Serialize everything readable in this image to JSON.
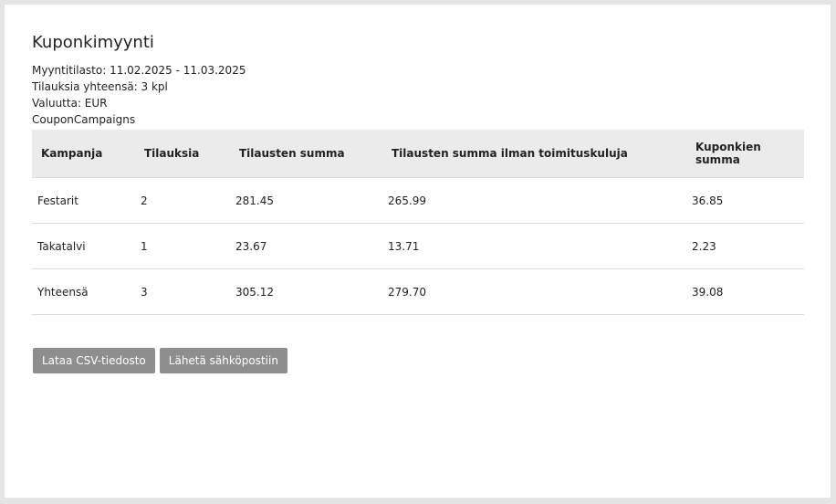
{
  "page": {
    "title": "Kuponkimyynti",
    "meta": [
      "Myyntitilasto: 11.02.2025 - 11.03.2025",
      "Tilauksia yhteensä: 3 kpl",
      "Valuutta: EUR",
      "CouponCampaigns"
    ]
  },
  "table": {
    "headers": [
      "Kampanja",
      "Tilauksia",
      "Tilausten summa",
      "Tilausten summa ilman toimituskuluja",
      "Kuponkien summa"
    ],
    "rows": [
      [
        "Festarit",
        "2",
        "281.45",
        "265.99",
        "36.85"
      ],
      [
        "Takatalvi",
        "1",
        "23.67",
        "13.71",
        "2.23"
      ],
      [
        "Yhteensä",
        "3",
        "305.12",
        "279.70",
        "39.08"
      ]
    ]
  },
  "actions": {
    "download_csv": "Lataa CSV-tiedosto",
    "send_email": "Lähetä sähköpostiin"
  },
  "colors": {
    "page_bg": "#e4e4e4",
    "panel_bg": "#ffffff",
    "header_bg": "#ebebeb",
    "button_bg": "#8e8e8e",
    "button_text": "#ffffff"
  }
}
